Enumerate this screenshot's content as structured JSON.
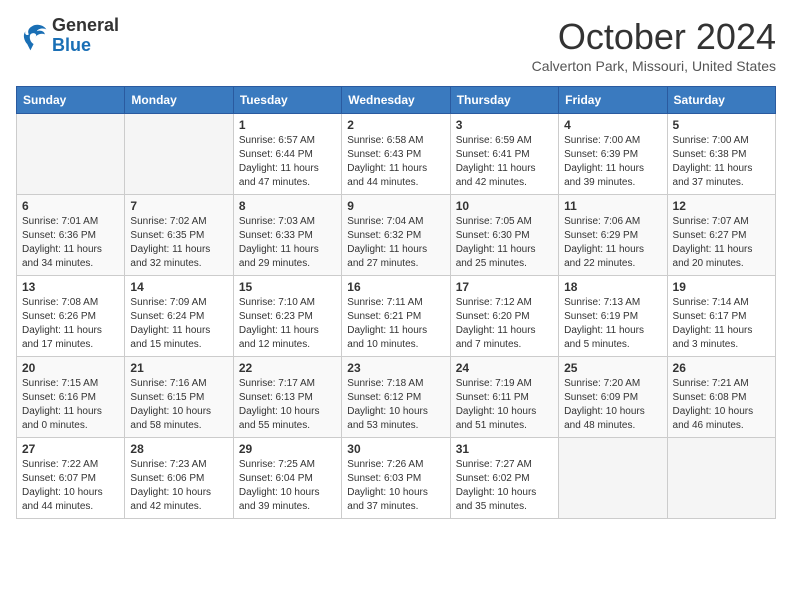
{
  "header": {
    "logo_line1": "General",
    "logo_line2": "Blue",
    "month_title": "October 2024",
    "location": "Calverton Park, Missouri, United States"
  },
  "weekdays": [
    "Sunday",
    "Monday",
    "Tuesday",
    "Wednesday",
    "Thursday",
    "Friday",
    "Saturday"
  ],
  "weeks": [
    [
      {
        "day": "",
        "empty": true
      },
      {
        "day": "",
        "empty": true
      },
      {
        "day": "1",
        "sunrise": "6:57 AM",
        "sunset": "6:44 PM",
        "daylight": "11 hours and 47 minutes."
      },
      {
        "day": "2",
        "sunrise": "6:58 AM",
        "sunset": "6:43 PM",
        "daylight": "11 hours and 44 minutes."
      },
      {
        "day": "3",
        "sunrise": "6:59 AM",
        "sunset": "6:41 PM",
        "daylight": "11 hours and 42 minutes."
      },
      {
        "day": "4",
        "sunrise": "7:00 AM",
        "sunset": "6:39 PM",
        "daylight": "11 hours and 39 minutes."
      },
      {
        "day": "5",
        "sunrise": "7:00 AM",
        "sunset": "6:38 PM",
        "daylight": "11 hours and 37 minutes."
      }
    ],
    [
      {
        "day": "6",
        "sunrise": "7:01 AM",
        "sunset": "6:36 PM",
        "daylight": "11 hours and 34 minutes."
      },
      {
        "day": "7",
        "sunrise": "7:02 AM",
        "sunset": "6:35 PM",
        "daylight": "11 hours and 32 minutes."
      },
      {
        "day": "8",
        "sunrise": "7:03 AM",
        "sunset": "6:33 PM",
        "daylight": "11 hours and 29 minutes."
      },
      {
        "day": "9",
        "sunrise": "7:04 AM",
        "sunset": "6:32 PM",
        "daylight": "11 hours and 27 minutes."
      },
      {
        "day": "10",
        "sunrise": "7:05 AM",
        "sunset": "6:30 PM",
        "daylight": "11 hours and 25 minutes."
      },
      {
        "day": "11",
        "sunrise": "7:06 AM",
        "sunset": "6:29 PM",
        "daylight": "11 hours and 22 minutes."
      },
      {
        "day": "12",
        "sunrise": "7:07 AM",
        "sunset": "6:27 PM",
        "daylight": "11 hours and 20 minutes."
      }
    ],
    [
      {
        "day": "13",
        "sunrise": "7:08 AM",
        "sunset": "6:26 PM",
        "daylight": "11 hours and 17 minutes."
      },
      {
        "day": "14",
        "sunrise": "7:09 AM",
        "sunset": "6:24 PM",
        "daylight": "11 hours and 15 minutes."
      },
      {
        "day": "15",
        "sunrise": "7:10 AM",
        "sunset": "6:23 PM",
        "daylight": "11 hours and 12 minutes."
      },
      {
        "day": "16",
        "sunrise": "7:11 AM",
        "sunset": "6:21 PM",
        "daylight": "11 hours and 10 minutes."
      },
      {
        "day": "17",
        "sunrise": "7:12 AM",
        "sunset": "6:20 PM",
        "daylight": "11 hours and 7 minutes."
      },
      {
        "day": "18",
        "sunrise": "7:13 AM",
        "sunset": "6:19 PM",
        "daylight": "11 hours and 5 minutes."
      },
      {
        "day": "19",
        "sunrise": "7:14 AM",
        "sunset": "6:17 PM",
        "daylight": "11 hours and 3 minutes."
      }
    ],
    [
      {
        "day": "20",
        "sunrise": "7:15 AM",
        "sunset": "6:16 PM",
        "daylight": "11 hours and 0 minutes."
      },
      {
        "day": "21",
        "sunrise": "7:16 AM",
        "sunset": "6:15 PM",
        "daylight": "10 hours and 58 minutes."
      },
      {
        "day": "22",
        "sunrise": "7:17 AM",
        "sunset": "6:13 PM",
        "daylight": "10 hours and 55 minutes."
      },
      {
        "day": "23",
        "sunrise": "7:18 AM",
        "sunset": "6:12 PM",
        "daylight": "10 hours and 53 minutes."
      },
      {
        "day": "24",
        "sunrise": "7:19 AM",
        "sunset": "6:11 PM",
        "daylight": "10 hours and 51 minutes."
      },
      {
        "day": "25",
        "sunrise": "7:20 AM",
        "sunset": "6:09 PM",
        "daylight": "10 hours and 48 minutes."
      },
      {
        "day": "26",
        "sunrise": "7:21 AM",
        "sunset": "6:08 PM",
        "daylight": "10 hours and 46 minutes."
      }
    ],
    [
      {
        "day": "27",
        "sunrise": "7:22 AM",
        "sunset": "6:07 PM",
        "daylight": "10 hours and 44 minutes."
      },
      {
        "day": "28",
        "sunrise": "7:23 AM",
        "sunset": "6:06 PM",
        "daylight": "10 hours and 42 minutes."
      },
      {
        "day": "29",
        "sunrise": "7:25 AM",
        "sunset": "6:04 PM",
        "daylight": "10 hours and 39 minutes."
      },
      {
        "day": "30",
        "sunrise": "7:26 AM",
        "sunset": "6:03 PM",
        "daylight": "10 hours and 37 minutes."
      },
      {
        "day": "31",
        "sunrise": "7:27 AM",
        "sunset": "6:02 PM",
        "daylight": "10 hours and 35 minutes."
      },
      {
        "day": "",
        "empty": true
      },
      {
        "day": "",
        "empty": true
      }
    ]
  ]
}
